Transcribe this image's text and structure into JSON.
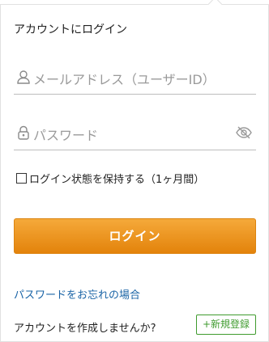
{
  "login": {
    "title": "アカウントにログイン",
    "email": {
      "placeholder": "メールアドレス（ユーザーID）",
      "icon": "user-icon"
    },
    "password": {
      "placeholder": "パスワード",
      "icon": "lock-icon",
      "toggle_icon": "eye-slash-icon"
    },
    "remember_label": "ログイン状態を保持する（1ヶ月間）",
    "remember_checked": false,
    "submit_label": "ログイン",
    "forgot_link": "パスワードをお忘れの場合",
    "create_prompt": "アカウントを作成しませんか?",
    "register_label": "+新規登録"
  },
  "colors": {
    "accent_orange": "#eb9322",
    "link_blue": "#1a64a6",
    "register_green": "#3f9b2e",
    "border_gray": "#e1e1e1"
  }
}
